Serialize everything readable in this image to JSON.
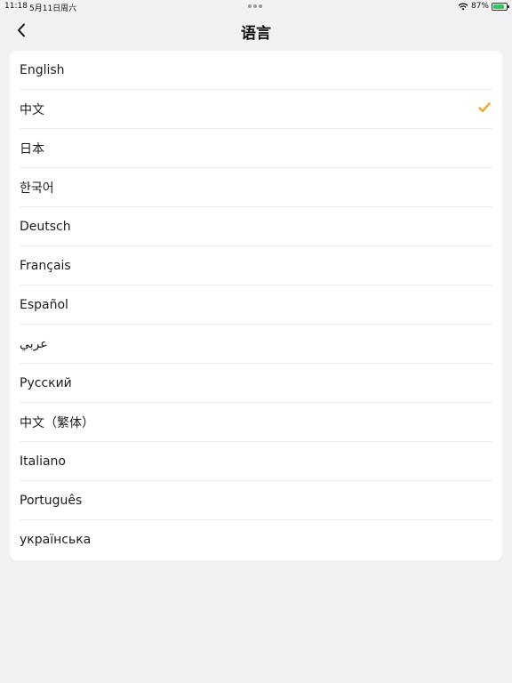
{
  "status_bar": {
    "time": "11:18",
    "date": "5月11日周六",
    "battery_text": "87%",
    "battery_level": 0.87
  },
  "header": {
    "title": "语言"
  },
  "languages": [
    {
      "label": "English",
      "selected": false
    },
    {
      "label": "中文",
      "selected": true
    },
    {
      "label": "日本",
      "selected": false
    },
    {
      "label": "한국어",
      "selected": false
    },
    {
      "label": "Deutsch",
      "selected": false
    },
    {
      "label": "Français",
      "selected": false
    },
    {
      "label": "Español",
      "selected": false
    },
    {
      "label": "عربي",
      "selected": false
    },
    {
      "label": "Русский",
      "selected": false
    },
    {
      "label": "中文（繁体）",
      "selected": false
    },
    {
      "label": "Italiano",
      "selected": false
    },
    {
      "label": "Português",
      "selected": false
    },
    {
      "label": "українська",
      "selected": false
    }
  ],
  "colors": {
    "accent": "#f5a623",
    "background": "#f2f2f4",
    "card": "#ffffff"
  },
  "icons": {
    "back": "chevron-left-icon",
    "check": "checkmark-icon",
    "wifi": "wifi-icon",
    "battery": "battery-icon"
  }
}
